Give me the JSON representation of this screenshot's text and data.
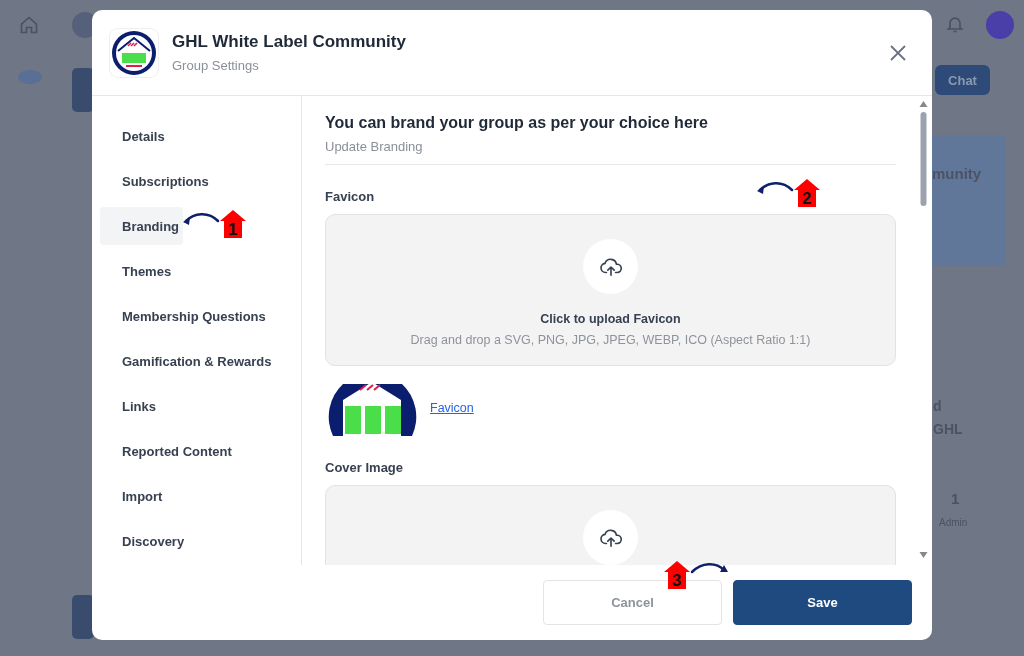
{
  "backdrop": {
    "chat_button": "Chat",
    "card_text": "munity",
    "side_texts": [
      "d",
      "GHL"
    ],
    "stat_value": "1",
    "stat_label": "Admin"
  },
  "dialog": {
    "title": "GHL White Label Community",
    "subtitle": "Group Settings"
  },
  "sidebar": {
    "items": [
      {
        "label": "Details",
        "selected": false
      },
      {
        "label": "Subscriptions",
        "selected": false
      },
      {
        "label": "Branding",
        "selected": true
      },
      {
        "label": "Themes",
        "selected": false
      },
      {
        "label": "Membership Questions",
        "selected": false
      },
      {
        "label": "Gamification & Rewards",
        "selected": false
      },
      {
        "label": "Links",
        "selected": false
      },
      {
        "label": "Reported Content",
        "selected": false
      },
      {
        "label": "Import",
        "selected": false
      },
      {
        "label": "Discovery",
        "selected": false
      }
    ]
  },
  "content": {
    "heading": "You can brand your group as per your choice here",
    "subheading": "Update Branding",
    "sections": [
      {
        "label": "Favicon",
        "upload_title": "Click to upload Favicon",
        "upload_hint": "Drag and drop a SVG, PNG, JPG, JPEG, WEBP, ICO (Aspect Ratio 1:1)",
        "preview_link": "Favicon"
      },
      {
        "label": "Cover Image"
      }
    ]
  },
  "footer": {
    "buttons": [
      {
        "label": "Cancel",
        "kind": "secondary"
      },
      {
        "label": "Save",
        "kind": "primary"
      }
    ]
  },
  "callouts": [
    {
      "number": "1"
    },
    {
      "number": "2"
    },
    {
      "number": "3"
    }
  ]
}
